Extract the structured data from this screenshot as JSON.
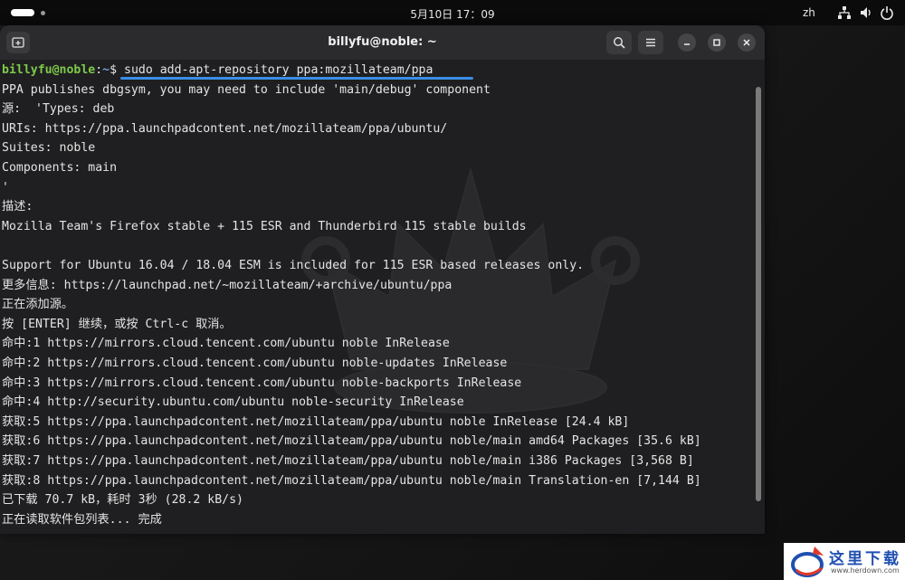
{
  "system_bar": {
    "clock": "5月10日  17：09",
    "language": "zh"
  },
  "window": {
    "title": "billyfu@noble: ~"
  },
  "terminal": {
    "prompt_user": "billyfu@noble",
    "prompt_sep": ":",
    "prompt_path": "~",
    "prompt_symbol": "$ ",
    "command": "sudo add-apt-repository ppa:mozillateam/ppa",
    "output": [
      "PPA publishes dbgsym, you may need to include 'main/debug' component",
      "源:  'Types: deb",
      "URIs: https://ppa.launchpadcontent.net/mozillateam/ppa/ubuntu/",
      "Suites: noble",
      "Components: main",
      "'",
      "描述:",
      "Mozilla Team's Firefox stable + 115 ESR and Thunderbird 115 stable builds",
      "",
      "Support for Ubuntu 16.04 / 18.04 ESM is included for 115 ESR based releases only.",
      "更多信息: https://launchpad.net/~mozillateam/+archive/ubuntu/ppa",
      "正在添加源。",
      "按 [ENTER] 继续，或按 Ctrl-c 取消。",
      "命中:1 https://mirrors.cloud.tencent.com/ubuntu noble InRelease",
      "命中:2 https://mirrors.cloud.tencent.com/ubuntu noble-updates InRelease",
      "命中:3 https://mirrors.cloud.tencent.com/ubuntu noble-backports InRelease",
      "命中:4 http://security.ubuntu.com/ubuntu noble-security InRelease",
      "获取:5 https://ppa.launchpadcontent.net/mozillateam/ppa/ubuntu noble InRelease [24.4 kB]",
      "获取:6 https://ppa.launchpadcontent.net/mozillateam/ppa/ubuntu noble/main amd64 Packages [35.6 kB]",
      "获取:7 https://ppa.launchpadcontent.net/mozillateam/ppa/ubuntu noble/main i386 Packages [3,568 B]",
      "获取:8 https://ppa.launchpadcontent.net/mozillateam/ppa/ubuntu noble/main Translation-en [7,144 B]",
      "已下载 70.7 kB，耗时 3秒 (28.2 kB/s)",
      "正在读取软件包列表... 完成"
    ]
  },
  "logo": {
    "text": "这里下载",
    "url": "www.herdown.com"
  },
  "colors": {
    "prompt_user": "#7ec94a",
    "prompt_path": "#6f9fd8",
    "terminal_bg": "#1f1f21",
    "titlebar_bg": "#2b2b2d",
    "highlight": "#3a8ee6"
  }
}
